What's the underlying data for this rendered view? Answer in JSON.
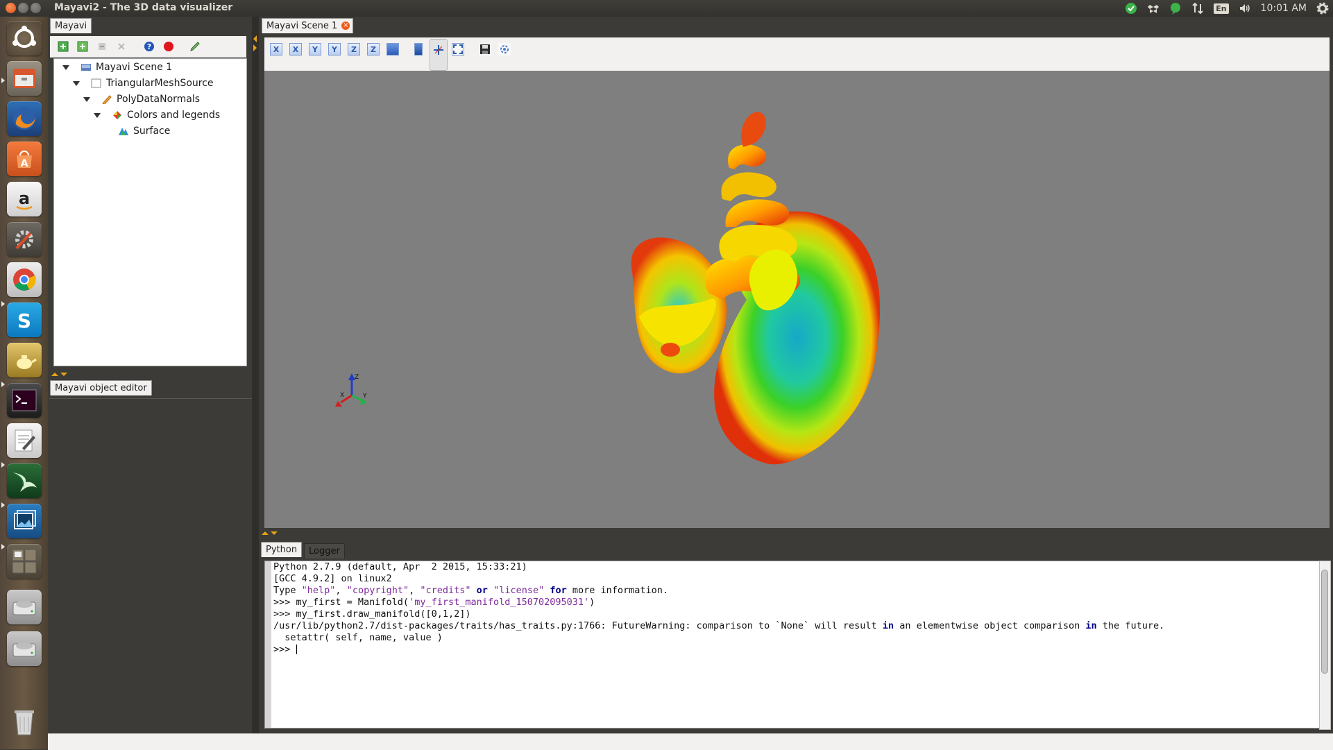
{
  "window": {
    "title": "Mayavi2 - The 3D data visualizer"
  },
  "tray": {
    "language": "En",
    "time": "10:01 AM"
  },
  "launcher": {
    "items": [
      "ubuntu-dash-icon",
      "files-icon",
      "firefox-icon",
      "software-center-icon",
      "amazon-icon",
      "system-settings-icon",
      "chrome-icon",
      "skype-icon",
      "teapot-app-icon",
      "terminal-icon",
      "text-editor-icon",
      "mayavi-icon",
      "image-viewer-icon",
      "workspace-switcher-icon",
      "drive-icon",
      "drive-icon-2",
      "trash-icon"
    ]
  },
  "left": {
    "top_tab": "Mayavi",
    "tree": [
      {
        "label": "Mayavi Scene 1",
        "level": 0
      },
      {
        "label": "TriangularMeshSource",
        "level": 1
      },
      {
        "label": "PolyDataNormals",
        "level": 2
      },
      {
        "label": "Colors and legends",
        "level": 3
      },
      {
        "label": "Surface",
        "level": 4
      }
    ],
    "editor_tab": "Mayavi object editor"
  },
  "scene": {
    "tab_label": "Mayavi Scene 1",
    "toolbar": [
      "view-x-pos",
      "view-x-neg",
      "view-y-pos",
      "view-y-neg",
      "view-z-pos",
      "view-z-neg",
      "isometric-view",
      "parallel-projection",
      "toggle-axes",
      "full-screen",
      "save-scene",
      "configure-scene"
    ],
    "axes": {
      "x": "X",
      "y": "Y",
      "z": "Z"
    }
  },
  "bottom": {
    "tabs": [
      "Python",
      "Logger"
    ],
    "console_lines": [
      "Python 2.7.9 (default, Apr  2 2015, 15:33:21)",
      "[GCC 4.9.2] on linux2",
      "Type \"help\", \"copyright\", \"credits\" or \"license\" for more information.",
      ">>> my_first = Manifold('my_first_manifold_150702095031')",
      ">>> my_first.draw_manifold([0,1,2])",
      "/usr/lib/python2.7/dist-packages/traits/has_traits.py:1766: FutureWarning: comparison to `None` will result in an elementwise object comparison in the future.",
      "  setattr( self, name, value )",
      ">>> "
    ]
  },
  "colors": {
    "accent": "#e0531c",
    "viewport_bg": "#7f7f7f",
    "panel_bg": "#3c3b37"
  }
}
